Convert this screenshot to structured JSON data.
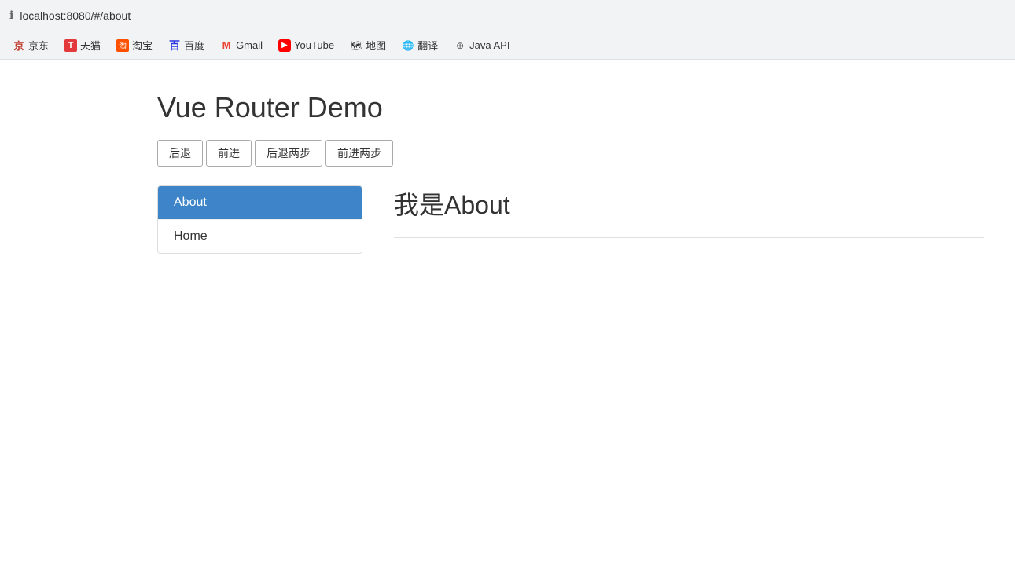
{
  "browser": {
    "address_bar": {
      "icon": "ℹ",
      "url": "localhost:8080/#/about"
    },
    "bookmarks": [
      {
        "id": "jingdong",
        "label": "京东",
        "icon": "京",
        "icon_color": "#c0392b",
        "icon_bg": "transparent"
      },
      {
        "id": "tianmao",
        "label": "天猫",
        "icon": "T",
        "icon_color": "#fff",
        "icon_bg": "#e4393c"
      },
      {
        "id": "taobao",
        "label": "淘宝",
        "icon": "淘",
        "icon_color": "#fff",
        "icon_bg": "#ff5000"
      },
      {
        "id": "baidu",
        "label": "百度",
        "icon": "百",
        "icon_color": "#2932e1",
        "icon_bg": "transparent"
      },
      {
        "id": "gmail",
        "label": "Gmail",
        "icon": "M",
        "icon_color": "#ea4335",
        "icon_bg": "transparent"
      },
      {
        "id": "youtube",
        "label": "YouTube",
        "icon": "▶",
        "icon_color": "#fff",
        "icon_bg": "#ff0000"
      },
      {
        "id": "maps",
        "label": "地图",
        "icon": "📍",
        "icon_color": "",
        "icon_bg": "transparent"
      },
      {
        "id": "translate",
        "label": "翻译",
        "icon": "🌐",
        "icon_color": "",
        "icon_bg": "transparent"
      },
      {
        "id": "javaapi",
        "label": "Java API",
        "icon": "⊕",
        "icon_color": "#555",
        "icon_bg": "transparent"
      }
    ]
  },
  "app": {
    "title": "Vue Router Demo",
    "nav_buttons": [
      {
        "id": "back",
        "label": "后退"
      },
      {
        "id": "forward",
        "label": "前进"
      },
      {
        "id": "back2",
        "label": "后退两步"
      },
      {
        "id": "forward2",
        "label": "前进两步"
      }
    ],
    "router_nav": [
      {
        "id": "about",
        "label": "About",
        "active": true
      },
      {
        "id": "home",
        "label": "Home",
        "active": false
      }
    ],
    "content": {
      "text": "我是About"
    }
  }
}
